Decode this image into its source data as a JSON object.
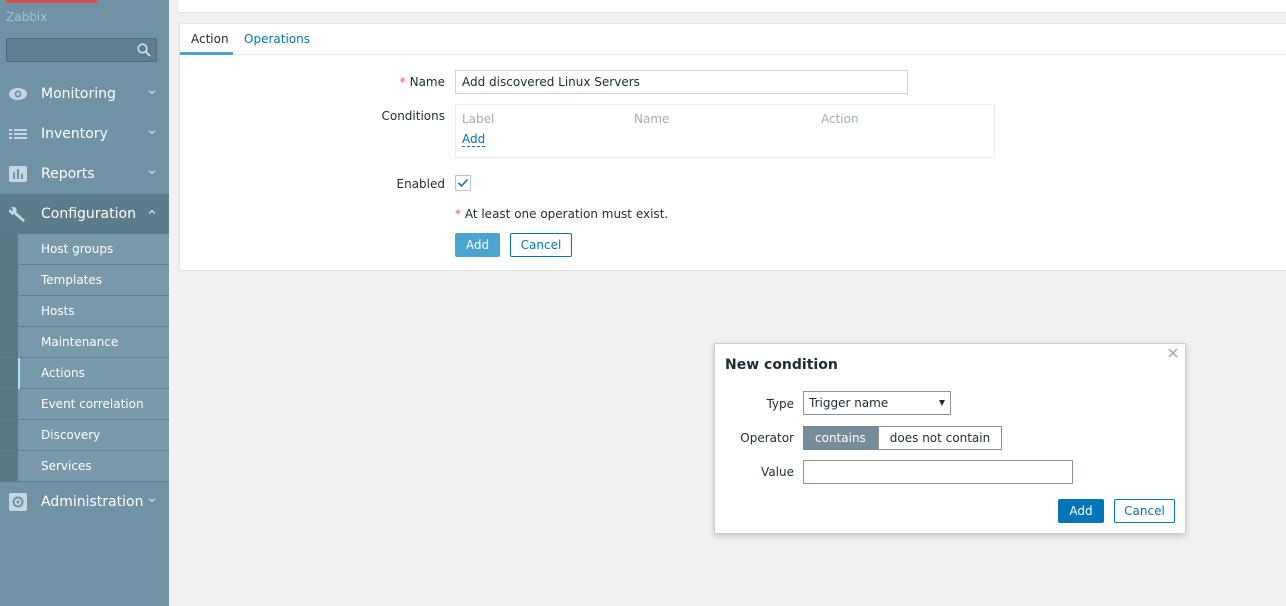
{
  "app": {
    "brand": "Zabbix"
  },
  "sidebar": {
    "search_placeholder": "",
    "menu": [
      {
        "label": "Monitoring",
        "icon": "eye-icon"
      },
      {
        "label": "Inventory",
        "icon": "list-icon"
      },
      {
        "label": "Reports",
        "icon": "bar-chart-icon"
      },
      {
        "label": "Configuration",
        "icon": "wrench-icon"
      },
      {
        "label": "Administration",
        "icon": "gear-icon"
      }
    ],
    "config_items": [
      "Host groups",
      "Templates",
      "Hosts",
      "Maintenance",
      "Actions",
      "Event correlation",
      "Discovery",
      "Services"
    ]
  },
  "form": {
    "tabs": [
      "Action",
      "Operations"
    ],
    "name_label": "Name",
    "name_value": "Add discovered Linux Servers",
    "required_mark": "*",
    "conditions_label": "Conditions",
    "conditions_headers": [
      "Label",
      "Name",
      "Action"
    ],
    "conditions_add": "Add",
    "enabled_label": "Enabled",
    "enabled": true,
    "note": "At least one operation must exist.",
    "add_button": "Add",
    "cancel_button": "Cancel"
  },
  "dialog": {
    "title": "New condition",
    "type_label": "Type",
    "type_value": "Trigger name",
    "operator_label": "Operator",
    "operator_options": [
      "contains",
      "does not contain"
    ],
    "operator_selected": "contains",
    "value_label": "Value",
    "value": "",
    "add_button": "Add",
    "cancel_button": "Cancel"
  },
  "colors": {
    "sidebar_bg": "#6f93a5",
    "accent": "#0275b8",
    "primary_button": "#4da3d0",
    "required": "#e45959"
  }
}
